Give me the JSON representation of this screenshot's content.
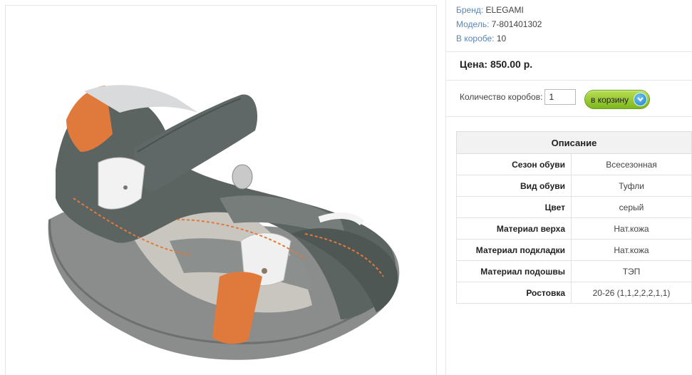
{
  "product": {
    "image_alt": "product-sandal-image",
    "brand_label": "Бренд:",
    "brand_value": "ELEGAMI",
    "model_label": "Модель:",
    "model_value": "7-801401302",
    "box_label": "В коробе:",
    "box_value": "10",
    "price_text": "Цена: 850.00 р.",
    "qty_label": "Количество коробов:",
    "qty_value": "1",
    "cart_button_label": "в корзину"
  },
  "description": {
    "title": "Описание",
    "rows": [
      {
        "key": "Сезон обуви",
        "value": "Всесезонная"
      },
      {
        "key": "Вид обуви",
        "value": "Туфли"
      },
      {
        "key": "Цвет",
        "value": "серый"
      },
      {
        "key": "Материал верха",
        "value": "Нат.кожа"
      },
      {
        "key": "Материал подкладки",
        "value": "Нат.кожа"
      },
      {
        "key": "Материал подошвы",
        "value": "ТЭП"
      },
      {
        "key": "Ростовка",
        "value": "20-26 (1,1,2,2,2,1,1)"
      }
    ]
  },
  "colors": {
    "link_blue": "#5b86b8",
    "button_green": "#8cc63f",
    "shoe_grey": "#5c6461",
    "shoe_orange": "#e07a3c"
  }
}
